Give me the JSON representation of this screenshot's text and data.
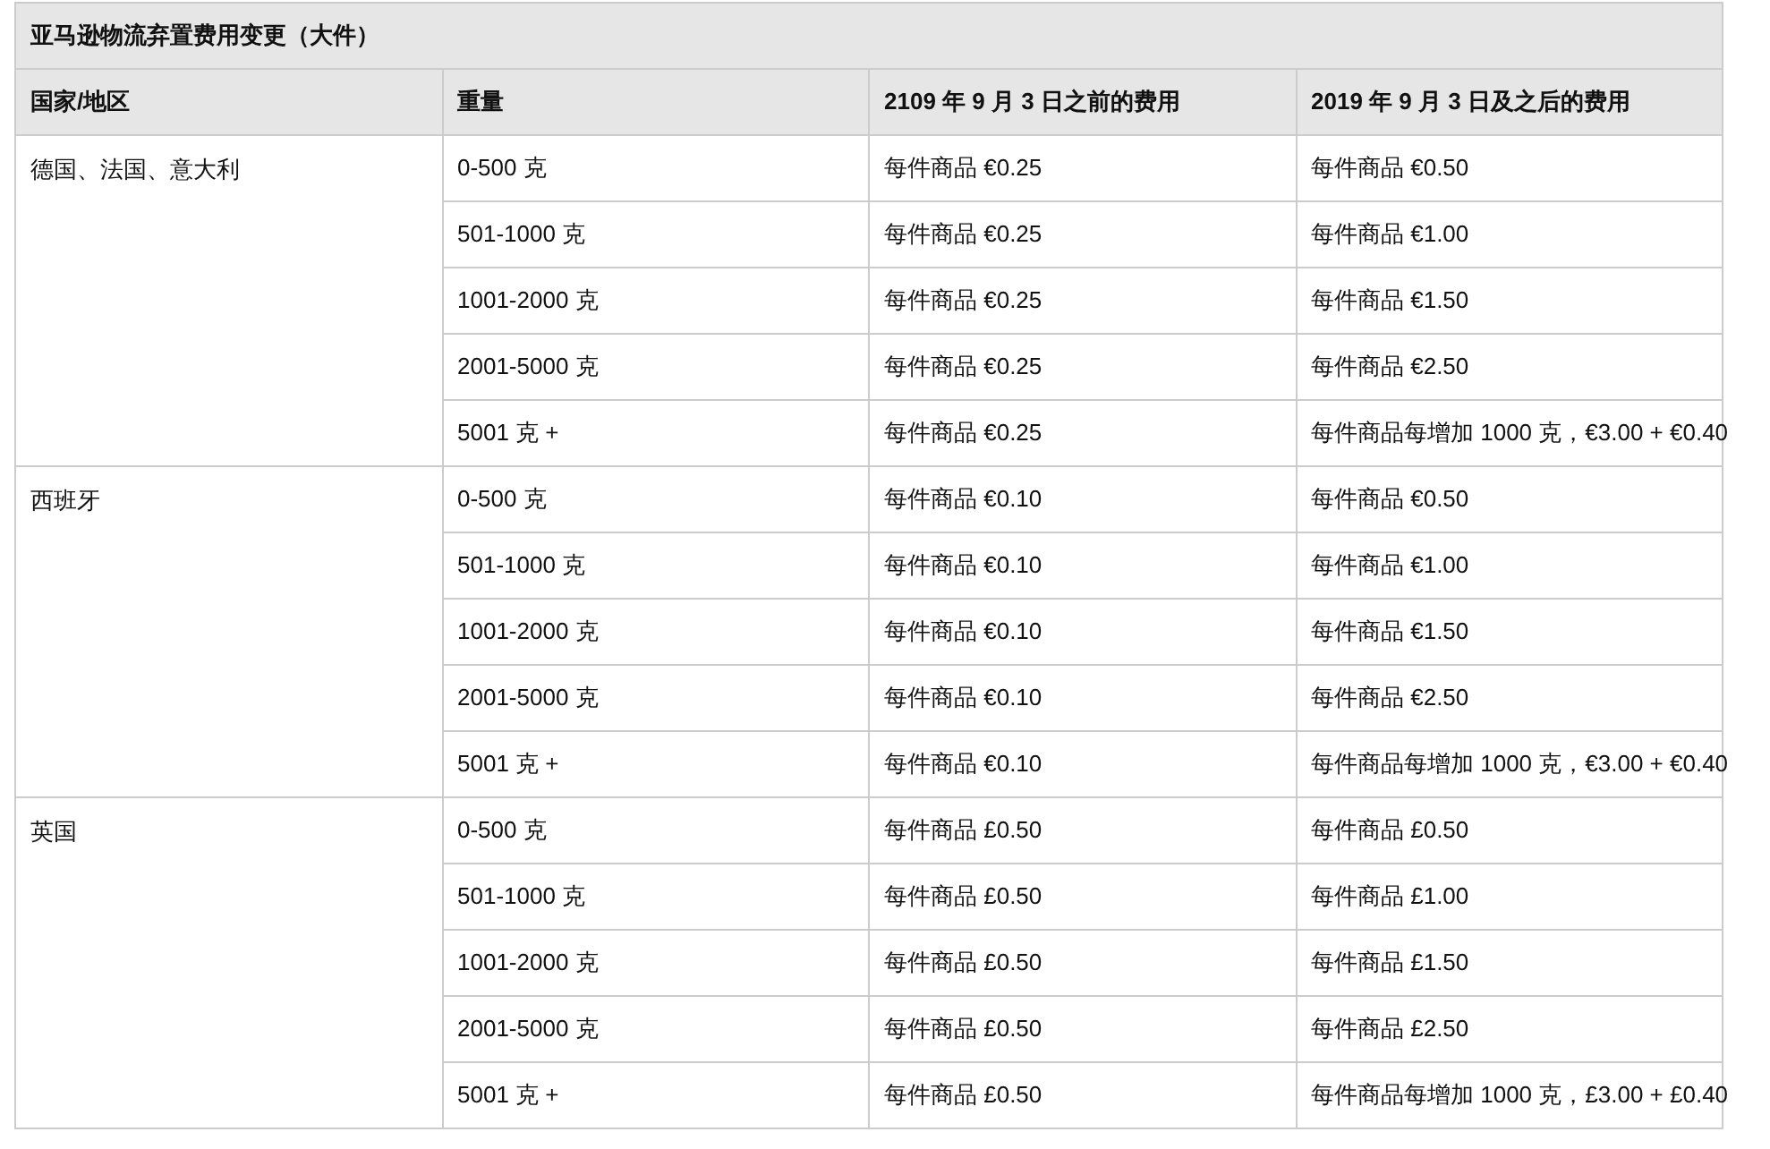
{
  "table": {
    "title": "亚马逊物流弃置费用变更（大件）",
    "columns": [
      "国家/地区",
      "重量",
      "2109 年 9 月 3 日之前的费用",
      "2019 年 9 月 3 日及之后的费用"
    ],
    "groups": [
      {
        "region": "德国、法国、意大利",
        "rows": [
          {
            "weight": "0-500 克",
            "before": "每件商品 €0.25",
            "after": "每件商品 €0.50"
          },
          {
            "weight": "501-1000 克",
            "before": "每件商品 €0.25",
            "after": "每件商品 €1.00"
          },
          {
            "weight": "1001-2000 克",
            "before": "每件商品 €0.25",
            "after": "每件商品 €1.50"
          },
          {
            "weight": "2001-5000 克",
            "before": "每件商品 €0.25",
            "after": "每件商品 €2.50"
          },
          {
            "weight": "5001 克 +",
            "before": "每件商品 €0.25",
            "after": "每件商品每增加 1000 克，€3.00 + €0.40"
          }
        ]
      },
      {
        "region": "西班牙",
        "rows": [
          {
            "weight": "0-500 克",
            "before": "每件商品 €0.10",
            "after": "每件商品 €0.50"
          },
          {
            "weight": "501-1000 克",
            "before": "每件商品 €0.10",
            "after": "每件商品 €1.00"
          },
          {
            "weight": "1001-2000 克",
            "before": "每件商品 €0.10",
            "after": "每件商品 €1.50"
          },
          {
            "weight": "2001-5000 克",
            "before": "每件商品 €0.10",
            "after": "每件商品 €2.50"
          },
          {
            "weight": "5001 克 +",
            "before": "每件商品 €0.10",
            "after": "每件商品每增加 1000 克，€3.00 + €0.40"
          }
        ]
      },
      {
        "region": "英国",
        "rows": [
          {
            "weight": "0-500 克",
            "before": "每件商品 £0.50",
            "after": "每件商品 £0.50"
          },
          {
            "weight": "501-1000 克",
            "before": "每件商品 £0.50",
            "after": "每件商品 £1.00"
          },
          {
            "weight": "1001-2000 克",
            "before": "每件商品 £0.50",
            "after": "每件商品 £1.50"
          },
          {
            "weight": "2001-5000 克",
            "before": "每件商品 £0.50",
            "after": "每件商品 £2.50"
          },
          {
            "weight": "5001 克 +",
            "before": "每件商品 £0.50",
            "after": "每件商品每增加 1000 克，£3.00 + £0.40"
          }
        ]
      }
    ]
  }
}
